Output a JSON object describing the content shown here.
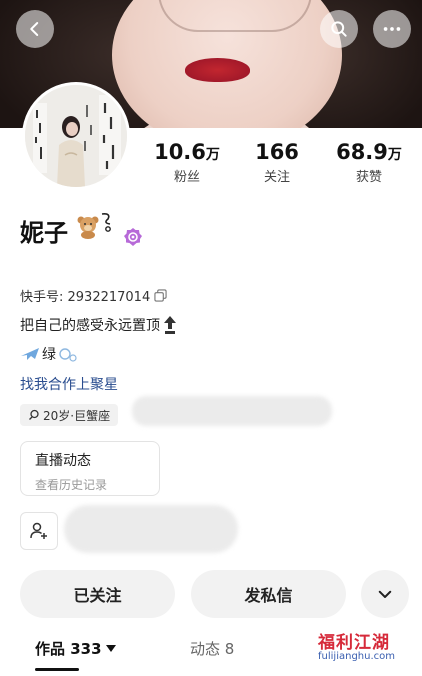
{
  "header": {
    "back_icon": "chevron-left-icon",
    "search_icon": "search-icon",
    "more_icon": "more-horizontal-icon"
  },
  "stats": [
    {
      "value": "10.6",
      "unit": "万",
      "label": "粉丝"
    },
    {
      "value": "166",
      "unit": "",
      "label": "关注"
    },
    {
      "value": "68.9",
      "unit": "万",
      "label": "获赞"
    }
  ],
  "profile": {
    "name": "妮子",
    "account_id_label": "快手号: 2932217014",
    "bio_line1": "把自己的感受永远置顶",
    "bio_line2": "绿",
    "cooperation_link": "找我合作上聚星",
    "tag": "20岁·巨蟹座"
  },
  "live_card": {
    "title": "直播动态",
    "subtitle": "查看历史记录"
  },
  "actions": {
    "followed": "已关注",
    "message": "发私信"
  },
  "tabs": [
    {
      "label": "作品 333",
      "active": true
    },
    {
      "label": "动态 8",
      "active": false
    }
  ],
  "watermark": {
    "main": "福利江湖",
    "sub": "fulijianghu.com"
  },
  "colors": {
    "link": "#2a4d8f",
    "watermark_red": "#d62a3a",
    "watermark_blue": "#3a5fb0"
  }
}
